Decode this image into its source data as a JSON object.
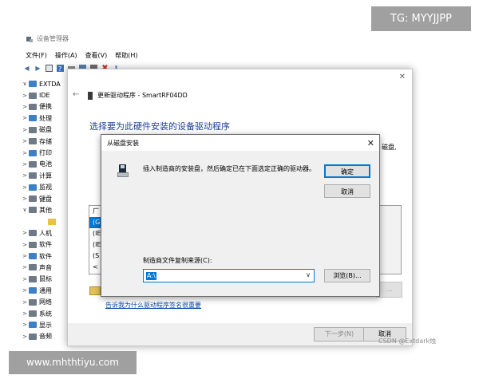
{
  "device_manager": {
    "title": "设备管理器",
    "menu": [
      "文件(F)",
      "操作(A)",
      "查看(V)",
      "帮助(H)"
    ],
    "tree": [
      {
        "exp": "∨",
        "label": "EXTDA",
        "icon": "computer-icon"
      },
      {
        "exp": ">",
        "label": "IDE",
        "icon": "ide-controller-icon"
      },
      {
        "exp": ">",
        "label": "便携",
        "icon": "portable-device-icon"
      },
      {
        "exp": ">",
        "label": "处理",
        "icon": "processor-icon"
      },
      {
        "exp": ">",
        "label": "磁盘",
        "icon": "disk-drive-icon"
      },
      {
        "exp": ">",
        "label": "存储",
        "icon": "storage-controller-icon"
      },
      {
        "exp": ">",
        "label": "打印",
        "icon": "printer-icon"
      },
      {
        "exp": ">",
        "label": "电池",
        "icon": "battery-icon"
      },
      {
        "exp": ">",
        "label": "计算",
        "icon": "computer-icon"
      },
      {
        "exp": ">",
        "label": "监视",
        "icon": "monitor-icon"
      },
      {
        "exp": ">",
        "label": "键盘",
        "icon": "keyboard-icon"
      },
      {
        "exp": "∨",
        "label": "其他",
        "icon": "other-devices-icon"
      },
      {
        "exp": "",
        "label": "",
        "icon": "unknown-device-warning-icon"
      },
      {
        "exp": ">",
        "label": "人机",
        "icon": "hid-icon"
      },
      {
        "exp": ">",
        "label": "软件",
        "icon": "software-component-icon"
      },
      {
        "exp": ">",
        "label": "软件",
        "icon": "software-device-icon"
      },
      {
        "exp": ">",
        "label": "声音",
        "icon": "sound-icon"
      },
      {
        "exp": ">",
        "label": "鼠标",
        "icon": "mouse-icon"
      },
      {
        "exp": ">",
        "label": "通用",
        "icon": "usb-icon"
      },
      {
        "exp": ">",
        "label": "网络",
        "icon": "network-adapter-icon"
      },
      {
        "exp": ">",
        "label": "系统",
        "icon": "system-device-icon"
      },
      {
        "exp": ">",
        "label": "显示",
        "icon": "display-adapter-icon"
      },
      {
        "exp": ">",
        "label": "音频",
        "icon": "audio-icon"
      }
    ]
  },
  "wizard": {
    "title": "更新驱动程序 - SmartRF04DD",
    "heading": "选择要为此硬件安装的设备驱动程序",
    "right_text": "磁盘,",
    "list_items": [
      "厂",
      "(G",
      "(IE",
      "(IE",
      "(S",
      "<"
    ],
    "disk_button": "...",
    "link": "告诉我为什么驱动程序签名很重要",
    "next_button": "下一步(N)",
    "cancel_button": "取消"
  },
  "disk_dialog": {
    "title": "从磁盘安装",
    "message": "插入制造商的安装盘，然后确定已在下面选定正确的驱动器。",
    "ok_button": "确定",
    "cancel_button": "取消",
    "source_label": "制造商文件复制来源(C):",
    "source_value": "A:\\",
    "browse_button": "浏览(B)..."
  },
  "watermarks": {
    "tg": "TG: MYYJJPP",
    "site": "www.mhthtiyu.com",
    "csdn": "CSDN @Extdark烛"
  }
}
